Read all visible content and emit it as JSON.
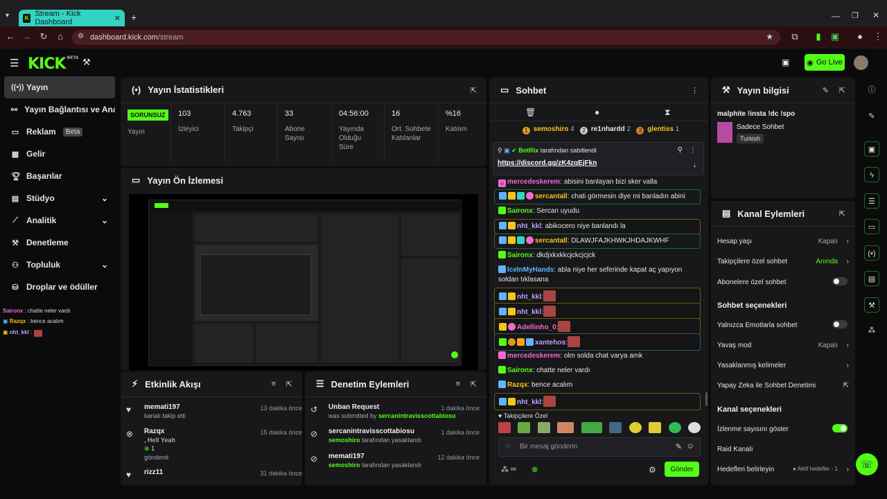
{
  "browser": {
    "tab_title": "Stream - Kick Dashboard",
    "url_host": "dashboard.kick.com",
    "url_path": "/stream"
  },
  "header": {
    "logo": "KICK",
    "logo_beta": "BETA",
    "go_live": "Go Live"
  },
  "sidebar": {
    "items": [
      {
        "label": "Yayın",
        "icon": "stream-icon"
      },
      {
        "label": "Yayın Bağlantısı ve Anahtarı",
        "icon": "link-icon"
      },
      {
        "label": "Reklam",
        "icon": "ad-icon",
        "badge": "Beta"
      },
      {
        "label": "Gelir",
        "icon": "revenue-icon"
      },
      {
        "label": "Başarılar",
        "icon": "trophy-icon"
      },
      {
        "label": "Stüdyo",
        "icon": "studio-icon"
      },
      {
        "label": "Analitik",
        "icon": "analytics-icon"
      },
      {
        "label": "Denetleme",
        "icon": "wrench-icon"
      },
      {
        "label": "Topluluk",
        "icon": "community-icon"
      },
      {
        "label": "Droplar ve ödüller",
        "icon": "drops-icon"
      }
    ],
    "mini_chat": [
      {
        "user": "Saironx",
        "text": " : chatte neler vardı"
      },
      {
        "user": "Razqx",
        "text": " : bence acalım"
      },
      {
        "user": "nht_kkl",
        "text": " :"
      }
    ]
  },
  "stats": {
    "title": "Yayın İstatistikleri",
    "status": "SORUNSUZ",
    "status_label": "Yayın",
    "items": [
      {
        "value": "103",
        "label": "İzleyici"
      },
      {
        "value": "4.763",
        "label": "Takipçi"
      },
      {
        "value": "33",
        "label": "Abone Sayısı"
      },
      {
        "value": "04:56:00",
        "label": "Yayında Olduğu Süre"
      },
      {
        "value": "16",
        "label": "Ort. Sohbete Katılanlar"
      },
      {
        "value": "%16",
        "label": "Katılım"
      }
    ]
  },
  "preview": {
    "title": "Yayın Ön İzlemesi"
  },
  "events": {
    "title": "Etkinlik Akışı",
    "items": [
      {
        "name": "memati197",
        "sub": "kanalı takip etti",
        "time": "13 dakika önce"
      },
      {
        "name": "Razqx",
        "sub": ", Hell Yeah",
        "extra": "1",
        "extra2": "gönderdi",
        "time": "15 dakika önce"
      },
      {
        "name": "rizz11",
        "sub": "",
        "time": "31 dakika önce"
      }
    ]
  },
  "moderation": {
    "title": "Denetim Eylemleri",
    "items": [
      {
        "name": "Unban Request",
        "prefix": "was submitted by ",
        "by": "sercanintravisscottabiosu",
        "time": "1 dakika önce"
      },
      {
        "name": "sercanintravisscottabiosu",
        "by": "semoshiro",
        "suffix": " tarafından yasaklandı",
        "time": "1 dakika önce"
      },
      {
        "name": "memati197",
        "by": "semoshiro",
        "suffix": " tarafından yasaklandı",
        "time": "12 dakika önce"
      }
    ]
  },
  "chat": {
    "title": "Sohbet",
    "top_gifters": [
      {
        "rank": "1",
        "name": "semoshiro",
        "count": "4"
      },
      {
        "rank": "2",
        "name": "re1nhardd",
        "count": "2"
      },
      {
        "rank": "3",
        "name": "glentiss",
        "count": "1"
      }
    ],
    "pinned_by": "BotRix",
    "pinned_suffix": " tarafından sabitlendi",
    "pinned_link": "https://discord.gg/zK4zqEjFkn",
    "messages": [
      {
        "user": "mercedeskerem",
        "text": ": abisini banlayan bizi sker valla",
        "color": "#f06bd0"
      },
      {
        "user": "sercantall",
        "text": ": chati görmesin diye mi banladın abini",
        "color": "#f5c518"
      },
      {
        "user": "Saironx",
        "text": ": Sercan uyudu",
        "color": "#53fc18"
      },
      {
        "user": "nht_kkl",
        "text": ": abikocero niye banlandı la",
        "color": "#b9a4ff"
      },
      {
        "user": "sercantall",
        "text": ": DLAWJFAJKHWKJHDAJKWHF",
        "color": "#f5c518"
      },
      {
        "user": "Saironx",
        "text": ": dkdjxkxkkcjckcjcjck",
        "color": "#53fc18"
      },
      {
        "user": "IceInMyHands",
        "text": ": abla niye her seferinde kapat aç yapıyon soldan tıklasana",
        "color": "#5fb4ff"
      },
      {
        "user": "nht_kkl",
        "text": ":",
        "color": "#b9a4ff"
      },
      {
        "user": "nht_kkl",
        "text": ":",
        "color": "#b9a4ff"
      },
      {
        "user": "Adellinho_0",
        "text": ":",
        "color": "#f06bd0"
      },
      {
        "user": "xantehos",
        "text": ":",
        "color": "#b9a4ff"
      },
      {
        "user": "mercedeskerem",
        "text": ": olm solda chat varya amk",
        "color": "#f06bd0"
      },
      {
        "user": "Saironx",
        "text": ": chatte neler vardı",
        "color": "#53fc18"
      },
      {
        "user": "Razqx",
        "text": ": bence acalım",
        "color": "#f5c518"
      },
      {
        "user": "nht_kkl",
        "text": ":",
        "color": "#b9a4ff"
      }
    ],
    "follower_only": "Takipçilere Özel",
    "input_placeholder": "Bir mesaj gönderin",
    "send": "Gönder"
  },
  "info": {
    "title": "Yayın bilgisi",
    "stream_title": "malphite !insta !dc !spo",
    "category": "Sadece Sohbet",
    "language": "Turkish"
  },
  "channel_actions": {
    "title": "Kanal Eylemleri",
    "rows": [
      {
        "label": "Hesap yaşı",
        "value": "Kapalı"
      },
      {
        "label": "Takipçilere özel sohbet",
        "value": "Anında"
      },
      {
        "label": "Abonelere özel sohbet",
        "value": ""
      }
    ],
    "chat_options_title": "Sohbet seçenekleri",
    "chat_options": [
      {
        "label": "Yalnızca Emotlarla sohbet",
        "value": ""
      },
      {
        "label": "Yavaş mod",
        "value": "Kapalı"
      },
      {
        "label": "Yasaklanmış kelimeler",
        "value": ""
      },
      {
        "label": "Yapay Zeka ile Sohbet Denetimi",
        "value": ""
      }
    ],
    "channel_options_title": "Kanal seçenekleri",
    "channel_options": [
      {
        "label": "İzlenme sayısını göster",
        "value": ""
      },
      {
        "label": "Raid Kanalı",
        "value": ""
      },
      {
        "label": "Hedefleri belirleyin",
        "value": "Aktif hedefler - 1"
      }
    ]
  },
  "colors": {
    "accent": "#53fc18",
    "panel": "#18181b",
    "tab": "#33d3c2"
  }
}
